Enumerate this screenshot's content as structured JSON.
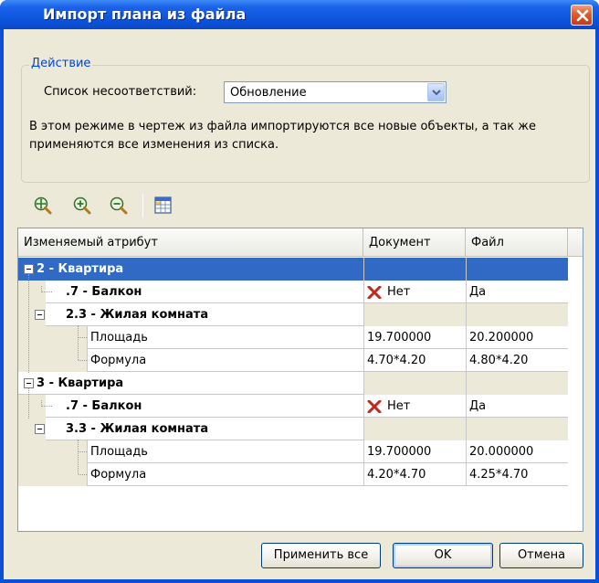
{
  "window": {
    "title": "Импорт плана из файла"
  },
  "action_group": {
    "legend": "Действие",
    "mismatch_label": "Список несоответствий:",
    "mismatch_value": "Обновление",
    "description": "В этом режиме в чертеж из файла импортируются все новые объекты, а так же применяются все изменения из списка."
  },
  "toolbar": {
    "icons": [
      "zoom-fit-icon",
      "zoom-in-icon",
      "zoom-out-icon",
      "table-settings-icon"
    ]
  },
  "grid": {
    "columns": [
      "Изменяемый атрибут",
      "Документ",
      "Файл"
    ],
    "rows": [
      {
        "attr": "2 - Квартира",
        "doc": "",
        "file": ""
      },
      {
        "attr": ".7 - Балкон",
        "doc": "Нет",
        "file": "Да"
      },
      {
        "attr": "2.3 - Жилая комната",
        "doc": "",
        "file": ""
      },
      {
        "attr": "Площадь",
        "doc": "19.700000",
        "file": "20.200000"
      },
      {
        "attr": "Формула",
        "doc": "4.70*4.20",
        "file": "4.80*4.20"
      },
      {
        "attr": "3 - Квартира",
        "doc": "",
        "file": ""
      },
      {
        "attr": ".7 - Балкон",
        "doc": "Нет",
        "file": "Да"
      },
      {
        "attr": "3.3 - Жилая комната",
        "doc": "",
        "file": ""
      },
      {
        "attr": "Площадь",
        "doc": "19.700000",
        "file": "20.000000"
      },
      {
        "attr": "Формула",
        "doc": "4.20*4.70",
        "file": "4.25*4.70"
      }
    ]
  },
  "buttons": {
    "apply_all": "Применить все",
    "ok": "OK",
    "cancel": "Отмена"
  },
  "colors": {
    "selection": "#316ac5",
    "titlebar": "#0c53dc",
    "legend_text": "#0046d5",
    "cross": "#c0281c"
  }
}
